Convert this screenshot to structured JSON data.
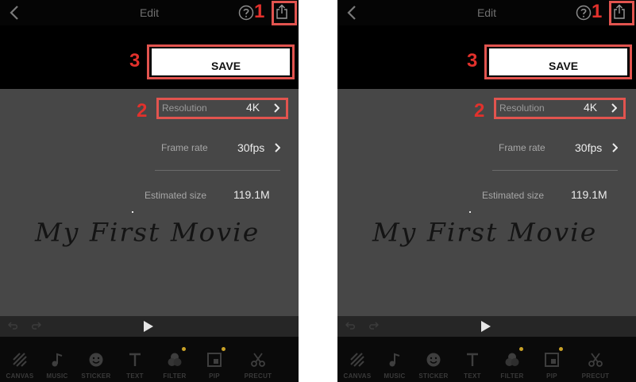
{
  "header": {
    "title": "Edit"
  },
  "callouts": {
    "one": "1",
    "two": "2",
    "three": "3"
  },
  "save": {
    "label": "SAVE"
  },
  "settings": {
    "resolution": {
      "label": "Resolution",
      "value": "4K"
    },
    "frame_rate": {
      "label": "Frame rate",
      "value": "30fps"
    },
    "estimated_size": {
      "label": "Estimated size",
      "value": "119.1M"
    }
  },
  "preview": {
    "title": "My First Movie"
  },
  "toolbar": {
    "items": [
      {
        "label": "CANVAS",
        "icon": "canvas-icon"
      },
      {
        "label": "MUSIC",
        "icon": "music-icon"
      },
      {
        "label": "STICKER",
        "icon": "sticker-icon"
      },
      {
        "label": "TEXT",
        "icon": "text-icon"
      },
      {
        "label": "FILTER",
        "icon": "filter-icon"
      },
      {
        "label": "PIP",
        "icon": "pip-icon"
      },
      {
        "label": "PRECUT",
        "icon": "scissors-icon"
      }
    ]
  },
  "colors": {
    "annotation": "#e2312c",
    "annotation_box": "#e2544f",
    "badge": "#c9a227",
    "content_bg": "#474747"
  }
}
